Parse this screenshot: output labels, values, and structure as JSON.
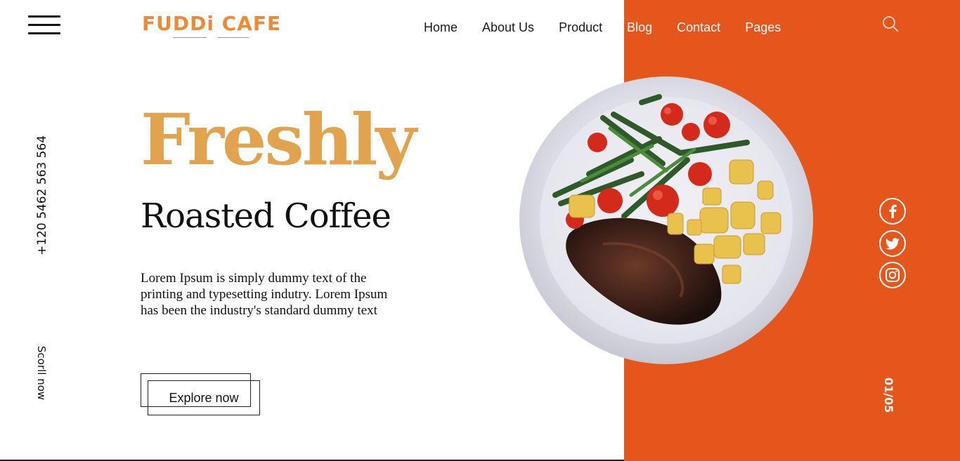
{
  "logo": {
    "text": "FUDDi CAFE"
  },
  "nav": {
    "items": [
      {
        "label": "Home"
      },
      {
        "label": "About Us"
      },
      {
        "label": "Product"
      },
      {
        "label": "Blog"
      },
      {
        "label": "Contact"
      },
      {
        "label": "Pages"
      }
    ]
  },
  "hero": {
    "title": "Freshly",
    "subtitle": "Roasted Coffee",
    "description": "Lorem Ipsum is simply dummy text of the printing and typesetting indutry. Lorem Ipsum has been the industry's standard dummy text",
    "cta_label": "Explore now"
  },
  "side": {
    "phone": "+120 5462 563 564",
    "scroll_label": "Scorll now",
    "slide_counter": "01/05"
  },
  "icons": {
    "menu": "hamburger-menu-icon",
    "search": "search-icon",
    "facebook": "facebook-icon",
    "twitter": "twitter-icon",
    "instagram": "instagram-icon"
  },
  "colors": {
    "accent_orange": "#e4561b",
    "title_gold": "#e2a34f",
    "logo_orange": "#ed8a3a",
    "text_dark": "#111111",
    "background": "#ffffff"
  }
}
